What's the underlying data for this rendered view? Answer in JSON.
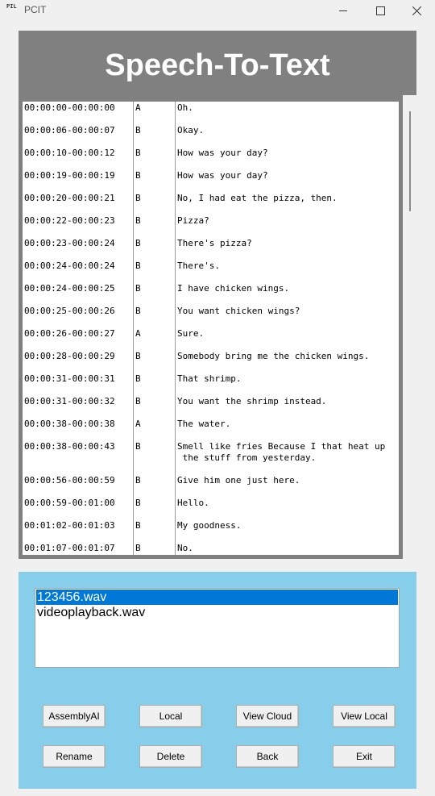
{
  "window": {
    "title": "PCIT",
    "icon_text": "PIL"
  },
  "header": {
    "title": "Speech-To-Text"
  },
  "transcript": [
    {
      "time": "00:00:00-00:00:00",
      "speaker": "A",
      "text": "Oh."
    },
    {
      "time": "00:00:06-00:00:07",
      "speaker": "B",
      "text": "Okay."
    },
    {
      "time": "00:00:10-00:00:12",
      "speaker": "B",
      "text": "How was your day?"
    },
    {
      "time": "00:00:19-00:00:19",
      "speaker": "B",
      "text": "How was your day?"
    },
    {
      "time": "00:00:20-00:00:21",
      "speaker": "B",
      "text": "No, I had eat the pizza, then."
    },
    {
      "time": "00:00:22-00:00:23",
      "speaker": "B",
      "text": "Pizza?"
    },
    {
      "time": "00:00:23-00:00:24",
      "speaker": "B",
      "text": "There's pizza?"
    },
    {
      "time": "00:00:24-00:00:24",
      "speaker": "B",
      "text": "There's."
    },
    {
      "time": "00:00:24-00:00:25",
      "speaker": "B",
      "text": "I have chicken wings."
    },
    {
      "time": "00:00:25-00:00:26",
      "speaker": "B",
      "text": "You want chicken wings?"
    },
    {
      "time": "00:00:26-00:00:27",
      "speaker": "A",
      "text": "Sure."
    },
    {
      "time": "00:00:28-00:00:29",
      "speaker": "B",
      "text": "Somebody bring me the chicken wings."
    },
    {
      "time": "00:00:31-00:00:31",
      "speaker": "B",
      "text": "That shrimp."
    },
    {
      "time": "00:00:31-00:00:32",
      "speaker": "B",
      "text": "You want the shrimp instead."
    },
    {
      "time": "00:00:38-00:00:38",
      "speaker": "A",
      "text": "The water."
    },
    {
      "time": "00:00:38-00:00:43",
      "speaker": "B",
      "text": "Smell like fries Because I that heat up\n the stuff from yesterday."
    },
    {
      "time": "00:00:56-00:00:59",
      "speaker": "B",
      "text": "Give him one just here."
    },
    {
      "time": "00:00:59-00:01:00",
      "speaker": "B",
      "text": "Hello."
    },
    {
      "time": "00:01:02-00:01:03",
      "speaker": "B",
      "text": "My goodness."
    },
    {
      "time": "00:01:07-00:01:07",
      "speaker": "B",
      "text": "No."
    }
  ],
  "files": [
    {
      "name": "123456.wav",
      "selected": true
    },
    {
      "name": "videoplayback.wav",
      "selected": false
    }
  ],
  "buttons": {
    "assemblyai": "AssemblyAI",
    "local": "Local",
    "view_cloud": "View Cloud",
    "view_local": "View Local",
    "rename": "Rename",
    "delete": "Delete",
    "back": "Back",
    "exit": "Exit"
  },
  "colors": {
    "header_bg": "#808080",
    "panel_bg": "#87ceeb",
    "selection": "#0078d7"
  }
}
